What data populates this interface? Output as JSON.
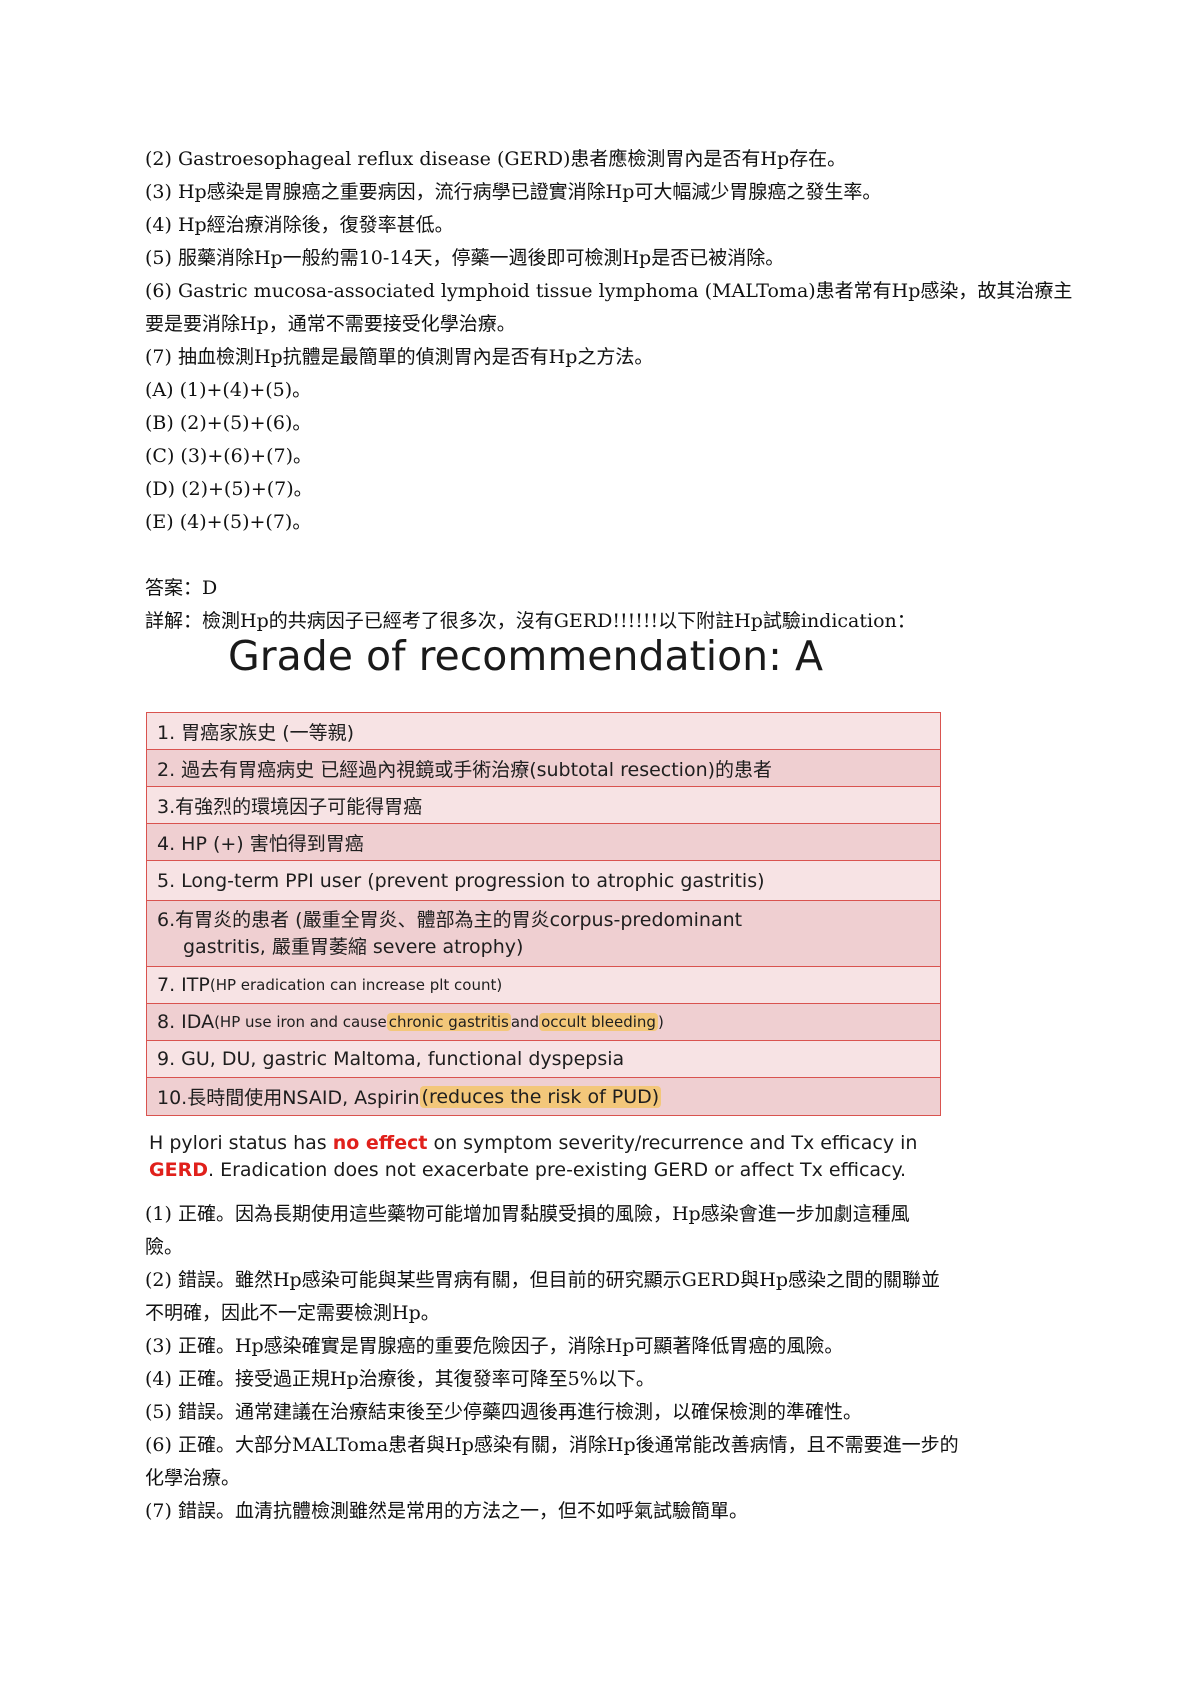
{
  "question_lines": [
    "(2) Gastroesophageal reflux disease (GERD)患者應檢測胃內是否有Hp存在。",
    "(3) Hp感染是胃腺癌之重要病因，流行病學已證實消除Hp可大幅減少胃腺癌之發生率。",
    "(4) Hp經治療消除後，復發率甚低。",
    "(5) 服藥消除Hp一般約需10-14天，停藥一週後即可檢測Hp是否已被消除。",
    "(6) Gastric mucosa-associated lymphoid tissue lymphoma (MALToma)患者常有Hp感染，故其治療主",
    "要是要消除Hp，通常不需要接受化學治療。",
    "(7) 抽血檢測Hp抗體是最簡單的偵測胃內是否有Hp之方法。",
    "(A) (1)+(4)+(5)。",
    "(B) (2)+(5)+(6)。",
    "(C) (3)+(6)+(7)。",
    "(D) (2)+(5)+(7)。",
    "(E) (4)+(5)+(7)。"
  ],
  "answer": "答案：D",
  "detail": "詳解：檢測Hp的共病因子已經考了很多次，沒有GERD!!!!!!以下附註Hp試驗indication：",
  "grade_title": "Grade of recommendation: A",
  "table": {
    "r1": "1. 胃癌家族史 (一等親)",
    "r2": "2. 過去有胃癌病史 已經過內視鏡或手術治療(subtotal resection)的患者",
    "r3": "3.有強烈的環境因子可能得胃癌",
    "r4": "4. HP (+) 害怕得到胃癌",
    "r5": "5. Long-term PPI user (prevent progression to atrophic gastritis)",
    "r6a": "6.有胃炎的患者 (嚴重全胃炎、體部為主的胃炎corpus-predominant",
    "r6b": "gastritis, 嚴重胃萎縮 severe atrophy)",
    "r7a": "7. ITP ",
    "r7b": "(HP eradication can increase plt count)",
    "r8a": "8. IDA ",
    "r8b": "(HP use iron and cause ",
    "r8c": "chronic gastritis",
    "r8d": " and ",
    "r8e": "occult bleeding",
    "r8f": ")",
    "r9": "9. GU, DU, gastric Maltoma, functional dyspepsia",
    "r10a": "10.長時間使用NSAID, Aspirin ",
    "r10b": "(reduces the risk of PUD)"
  },
  "note": {
    "a": "H pylori status has ",
    "b": "no effect",
    "c": " on symptom severity/recurrence and Tx efficacy in",
    "d": "GERD",
    "e": ". Eradication does not exacerbate pre-existing GERD or affect Tx efficacy."
  },
  "explanation_lines": [
    "(1) 正確。因為長期使用這些藥物可能增加胃黏膜受損的風險，Hp感染會進一步加劇這種風",
    "險。",
    "(2) 錯誤。雖然Hp感染可能與某些胃病有關，但目前的研究顯示GERD與Hp感染之間的關聯並",
    "不明確，因此不一定需要檢測Hp。",
    "(3) 正確。Hp感染確實是胃腺癌的重要危險因子，消除Hp可顯著降低胃癌的風險。",
    "(4) 正確。接受過正規Hp治療後，其復發率可降至5%以下。",
    "(5) 錯誤。通常建議在治療結束後至少停藥四週後再進行檢測，以確保檢測的準確性。",
    "(6) 正確。大部分MALToma患者與Hp感染有關，消除Hp後通常能改善病情，且不需要進一步的",
    "化學治療。",
    "(7) 錯誤。血清抗體檢測雖然是常用的方法之一，但不如呼氣試驗簡單。"
  ],
  "colors": {
    "table_border": "#d9534f",
    "row_light": "#f7e3e4",
    "row_dark": "#efcfd1",
    "highlight": "#f3c77a",
    "emphasis_red": "#e0201b"
  }
}
